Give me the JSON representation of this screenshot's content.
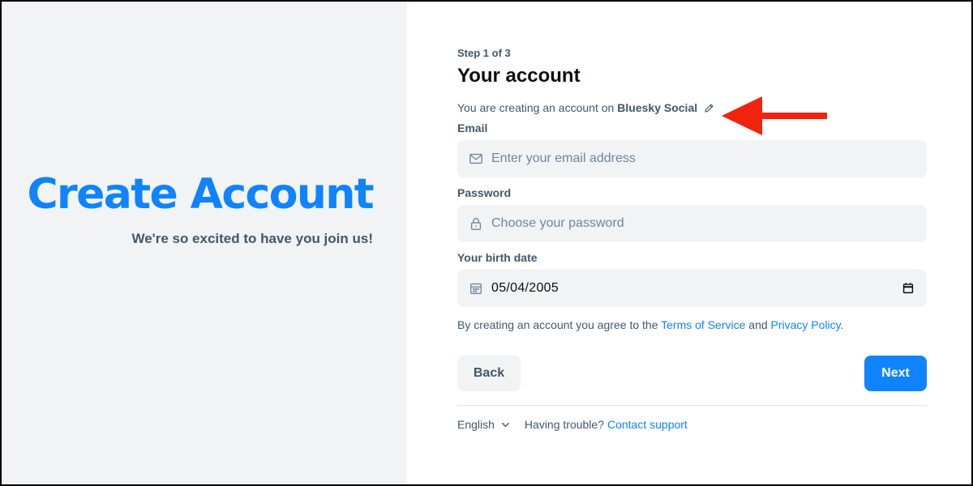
{
  "hero": {
    "title": "Create Account",
    "subtitle": "We're so excited to have you join us!"
  },
  "form": {
    "step": "Step 1 of 3",
    "title": "Your account",
    "creating_prefix": "You are creating an account on",
    "service_name": "Bluesky Social",
    "email": {
      "label": "Email",
      "placeholder": "Enter your email address",
      "icon": "envelope-icon"
    },
    "password": {
      "label": "Password",
      "placeholder": "Choose your password",
      "icon": "lock-icon"
    },
    "birthdate": {
      "label": "Your birth date",
      "value": "05/04/2005",
      "icon": "calendar-icon"
    },
    "terms": {
      "prefix": "By creating an account you agree to the",
      "tos": "Terms of Service",
      "and": "and",
      "privacy": "Privacy Policy",
      "suffix": "."
    },
    "back_label": "Back",
    "next_label": "Next"
  },
  "footer": {
    "language": "English",
    "trouble": "Having trouble?",
    "support": "Contact support"
  },
  "colors": {
    "accent": "#1083fe",
    "muted_text": "#42576c",
    "field_bg": "#f1f3f5",
    "annotation_arrow": "#f0230f"
  }
}
